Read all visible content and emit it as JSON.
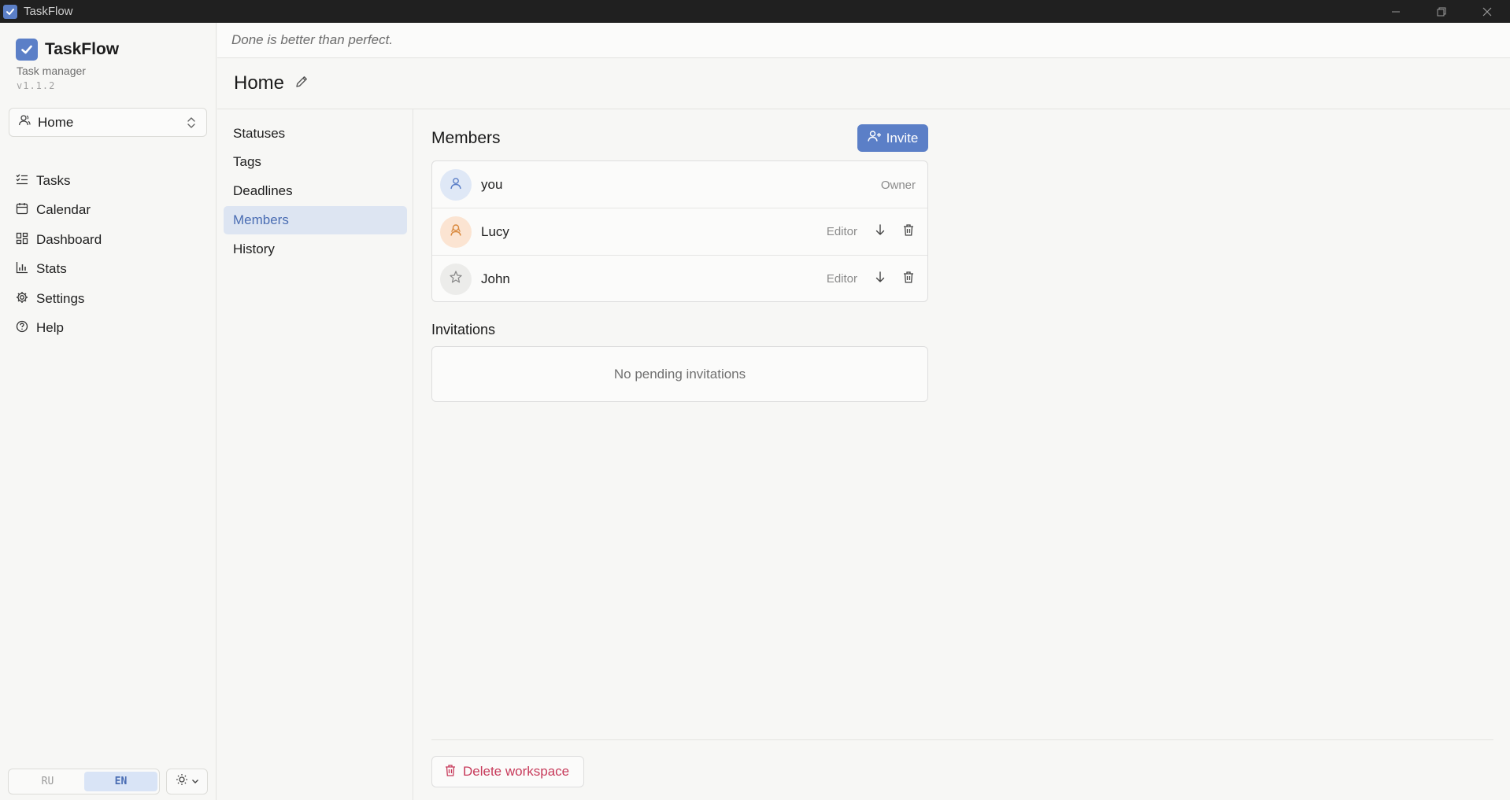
{
  "window": {
    "title": "TaskFlow"
  },
  "brand": {
    "name": "TaskFlow",
    "subtitle": "Task manager",
    "version": "v1.1.2"
  },
  "workspace_select": {
    "value": "Home"
  },
  "nav": {
    "items": [
      {
        "label": "Tasks",
        "icon": "list-check-icon"
      },
      {
        "label": "Calendar",
        "icon": "calendar-icon"
      },
      {
        "label": "Dashboard",
        "icon": "dashboard-grid-icon"
      },
      {
        "label": "Stats",
        "icon": "bar-chart-icon"
      },
      {
        "label": "Settings",
        "icon": "gear-icon"
      },
      {
        "label": "Help",
        "icon": "help-circle-icon"
      }
    ]
  },
  "language": {
    "options": [
      "RU",
      "EN"
    ],
    "selected": "EN"
  },
  "header": {
    "quote": "Done is better than perfect."
  },
  "page": {
    "title": "Home"
  },
  "subnav": {
    "items": [
      "Statuses",
      "Tags",
      "Deadlines",
      "Members",
      "History"
    ],
    "active": "Members"
  },
  "members": {
    "title": "Members",
    "invite_label": "Invite",
    "rows": [
      {
        "name": "you",
        "role": "Owner"
      },
      {
        "name": "Lucy",
        "role": "Editor"
      },
      {
        "name": "John",
        "role": "Editor"
      }
    ]
  },
  "invitations": {
    "title": "Invitations",
    "empty_text": "No pending invitations"
  },
  "danger": {
    "delete_label": "Delete workspace"
  },
  "colors": {
    "accent": "#5b7fc7",
    "danger": "#c73a5a",
    "active_bg": "#dde5f2"
  }
}
